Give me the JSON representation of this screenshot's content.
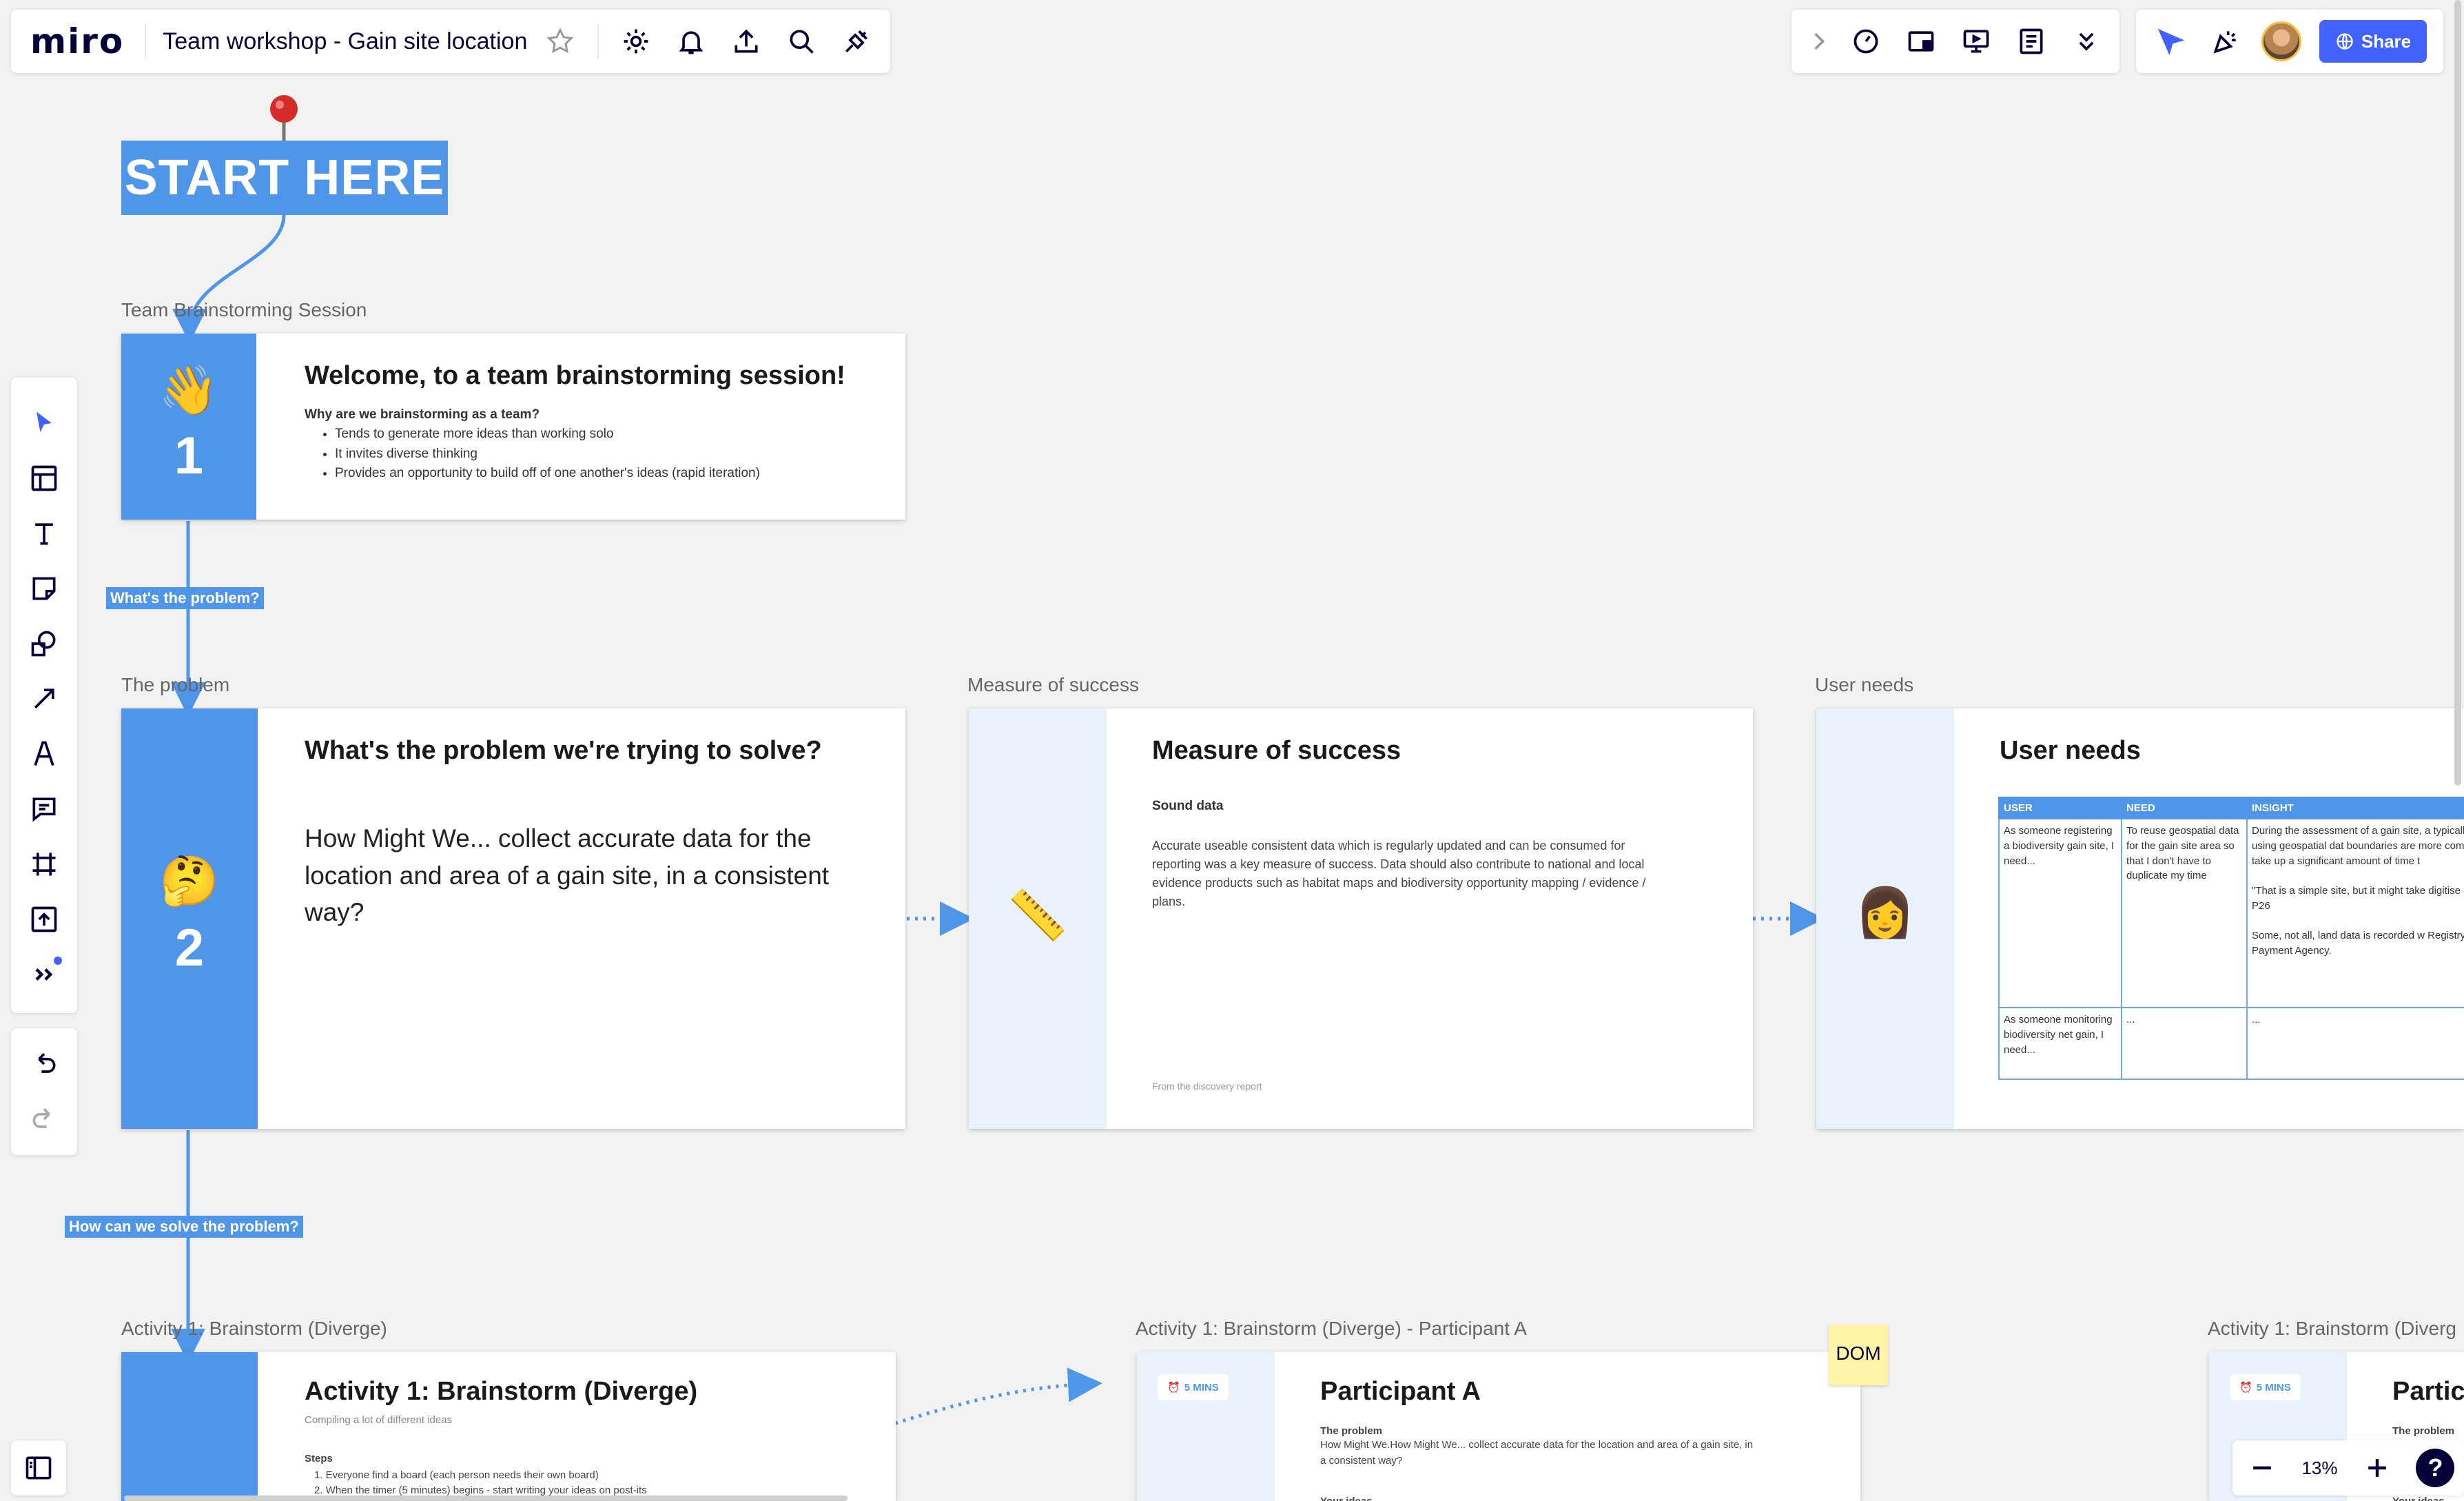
{
  "app": {
    "logo": "miro",
    "board_title": "Team workshop - Gain site location",
    "share_label": "Share",
    "zoom": "13%",
    "help": "?"
  },
  "icons": {
    "top_left": [
      "star-icon",
      "settings-icon",
      "bell-icon",
      "export-icon",
      "search-icon",
      "integrations-icon"
    ],
    "top_right": [
      "chevron-right-icon",
      "timer-icon",
      "frames-icon",
      "present-icon",
      "notes-icon",
      "more-chevron-icon"
    ],
    "left_tools": [
      "select-icon",
      "templates-icon",
      "text-icon",
      "sticky-note-icon",
      "shapes-icon",
      "line-icon",
      "pen-icon",
      "comment-icon",
      "frame-icon",
      "upload-icon",
      "more-tools-icon"
    ]
  },
  "canvas": {
    "start_here": "START HERE",
    "frame_labels": {
      "session": "Team Brainstorming Session",
      "problem": "The problem",
      "measure": "Measure of success",
      "user_needs": "User needs",
      "activity1": "Activity 1: Brainstorm (Diverge)",
      "participant_a": "Activity 1: Brainstorm (Diverge) - Participant A",
      "participant_b": "Activity 1: Brainstorm (Diverg"
    },
    "connector_tags": {
      "whats_problem": "What's the problem?",
      "how_solve": "How can we solve the problem?"
    },
    "welcome": {
      "number": "1",
      "emoji": "👋",
      "title": "Welcome, to a team brainstorming session!",
      "subtitle": "Why are we brainstorming as a team?",
      "bullets": [
        "Tends to generate more ideas than working solo",
        "It invites diverse thinking",
        "Provides an opportunity to build off of one another's ideas (rapid iteration)"
      ]
    },
    "problem": {
      "number": "2",
      "emoji": "🤔",
      "title": "What's the problem we're trying to solve?",
      "body": "How Might We... collect accurate data for the location and area of a gain site, in a consistent way?"
    },
    "measure": {
      "emoji": "📏",
      "title": "Measure of success",
      "subtitle": "Sound data",
      "body": "Accurate useable consistent data which is regularly updated and can be consumed for reporting was a key measure of success. Data should also contribute to national and local evidence products such as habitat maps and biodiversity opportunity mapping / evidence / plans.",
      "footer": "From the discovery report"
    },
    "user_needs": {
      "emoji": "👩",
      "title": "User needs",
      "headers": [
        "USER",
        "NEED",
        "INSIGHT"
      ],
      "rows": [
        [
          "As someone registering a biodiversity gain site, I need...",
          "To reuse geospatial data for the gain site area so that I don't have to duplicate my time",
          "During the assessment of a gain site, a typically digitised using geospatial dat boundaries are more complex than ot take up a significant amount of time t\n\n\"That is a simple site, but it might take digitise a boundary\" P26\n\nSome, not all, land data is recorded w Registry and Rural Payment Agency."
        ],
        [
          "As someone monitoring biodiversity net gain, I need...",
          "...",
          "..."
        ]
      ]
    },
    "activity": {
      "title": "Activity 1: Brainstorm (Diverge)",
      "subtitle": "Compiling a lot of different ideas",
      "steps_label": "Steps",
      "steps": [
        "1. Everyone find a board (each person needs their own board)",
        "2. When the timer (5 minutes) begins - start writing your ideas on post-its"
      ]
    },
    "participant_a": {
      "timer": "5 MINS",
      "title": "Participant A",
      "problem_label": "The problem",
      "problem_text": "How Might We.How Might We... collect accurate data for the location and area of a gain site, in a consistent way?",
      "ideas_label": "Your ideas"
    },
    "participant_b": {
      "timer": "5 MINS",
      "title": "Partic",
      "problem_label": "The problem",
      "ideas_label": "Your ideas"
    },
    "sticky": "DOM"
  }
}
